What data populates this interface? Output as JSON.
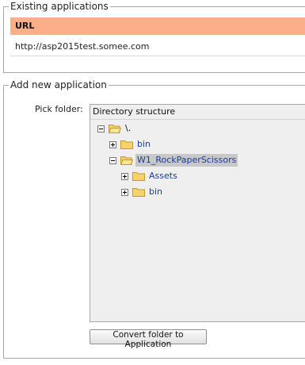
{
  "existing": {
    "legend": "Existing applications",
    "column_header": "URL",
    "rows": [
      {
        "url": "http://asp2015test.somee.com"
      }
    ]
  },
  "add_new": {
    "legend": "Add new application",
    "pick_label": "Pick folder:",
    "tree": {
      "header": "Directory structure",
      "nodes": [
        {
          "label": "\\.",
          "toggle": "minus",
          "icon": "folder-icon"
        },
        {
          "label": "bin",
          "toggle": "plus",
          "icon": "folder-icon"
        },
        {
          "label": "W1_RockPaperScissors",
          "toggle": "minus",
          "icon": "folder-icon",
          "selected": true
        },
        {
          "label": "Assets",
          "toggle": "plus",
          "icon": "folder-icon"
        },
        {
          "label": "bin",
          "toggle": "plus",
          "icon": "folder-icon"
        }
      ]
    },
    "convert_button": "Convert folder to Application"
  },
  "colors": {
    "header_bg": "#fbaf88",
    "link_text": "#1a3c9b",
    "selected_bg": "#c8c8c8",
    "tree_bg": "#efefef"
  }
}
